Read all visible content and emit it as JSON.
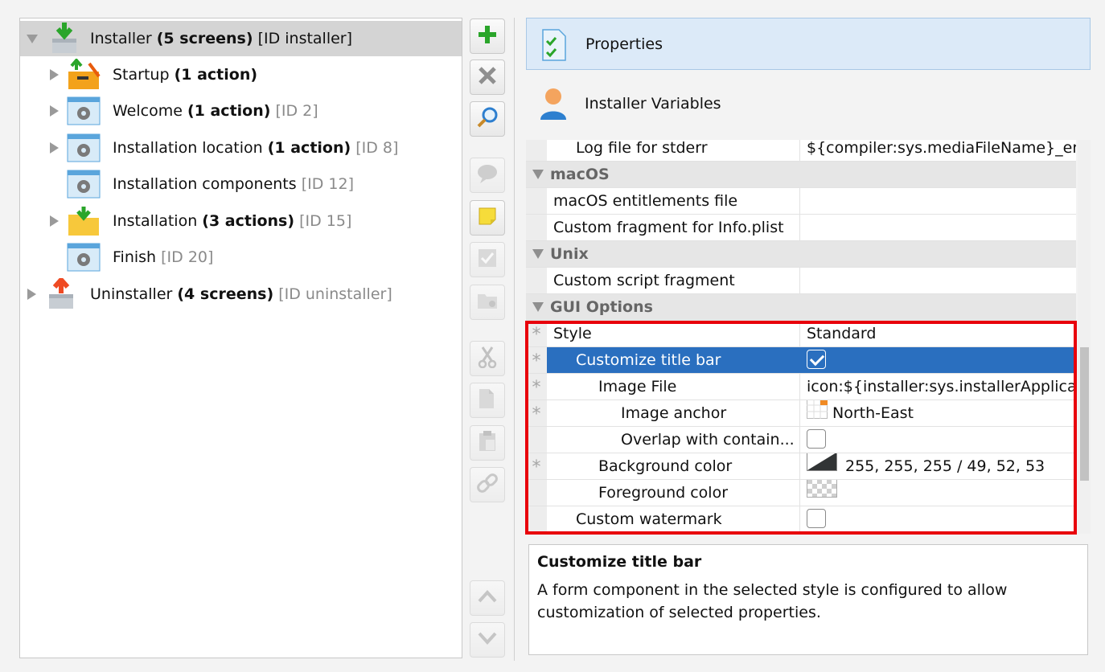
{
  "tree": {
    "items": [
      {
        "name": "Installer",
        "bold": "(5 screens)",
        "id": "[ID installer]"
      },
      {
        "name": "Startup",
        "bold": "(1 action)",
        "id": ""
      },
      {
        "name": "Welcome",
        "bold": "(1 action)",
        "id": "[ID 2]"
      },
      {
        "name": "Installation location",
        "bold": "(1 action)",
        "id": "[ID 8]"
      },
      {
        "name": "Installation components",
        "bold": "",
        "id": "[ID 12]"
      },
      {
        "name": "Installation",
        "bold": "(3 actions)",
        "id": "[ID 15]"
      },
      {
        "name": "Finish",
        "bold": "",
        "id": "[ID 20]"
      },
      {
        "name": "Uninstaller",
        "bold": "(4 screens)",
        "id": "[ID uninstaller]"
      }
    ]
  },
  "toolbar": {
    "icons": [
      "add-icon",
      "delete-icon",
      "search-icon",
      "comment-icon",
      "note-icon",
      "check-icon",
      "folder-icon",
      "cut-icon",
      "copy-icon",
      "paste-icon",
      "link-icon",
      "move-up-icon",
      "move-down-icon"
    ]
  },
  "header": {
    "properties_label": "Properties",
    "variables_label": "Installer Variables"
  },
  "grid": {
    "log_stderr": {
      "name": "Log file for stderr",
      "value": "${compiler:sys.mediaFileName}_err..."
    },
    "cat_macos": "macOS",
    "macos_entitlements": {
      "name": "macOS entitlements file",
      "value": ""
    },
    "custom_fragment_plist": {
      "name": "Custom fragment for Info.plist",
      "value": ""
    },
    "cat_unix": "Unix",
    "custom_script": {
      "name": "Custom script fragment",
      "value": ""
    },
    "cat_gui": "GUI Options",
    "style": {
      "name": "Style",
      "value": "Standard"
    },
    "customize_title_bar": {
      "name": "Customize title bar",
      "checked": true
    },
    "image_file": {
      "name": "Image File",
      "value": "icon:${installer:sys.installerApplica..."
    },
    "image_anchor": {
      "name": "Image anchor",
      "value": "North-East"
    },
    "overlap": {
      "name": "Overlap with contain...",
      "checked": false
    },
    "background_color": {
      "name": "Background color",
      "value": "255, 255, 255 / 49, 52, 53"
    },
    "foreground_color": {
      "name": "Foreground color",
      "value": ""
    },
    "custom_watermark": {
      "name": "Custom watermark",
      "checked": false
    },
    "modified_marker": "*"
  },
  "help": {
    "title": "Customize title bar",
    "body": "A form component in the selected style is configured to allow customization of selected properties."
  },
  "colors": {
    "selection": "#2a6fbf",
    "highlight_box": "#e8000b",
    "header_bg": "#dceaf8"
  }
}
